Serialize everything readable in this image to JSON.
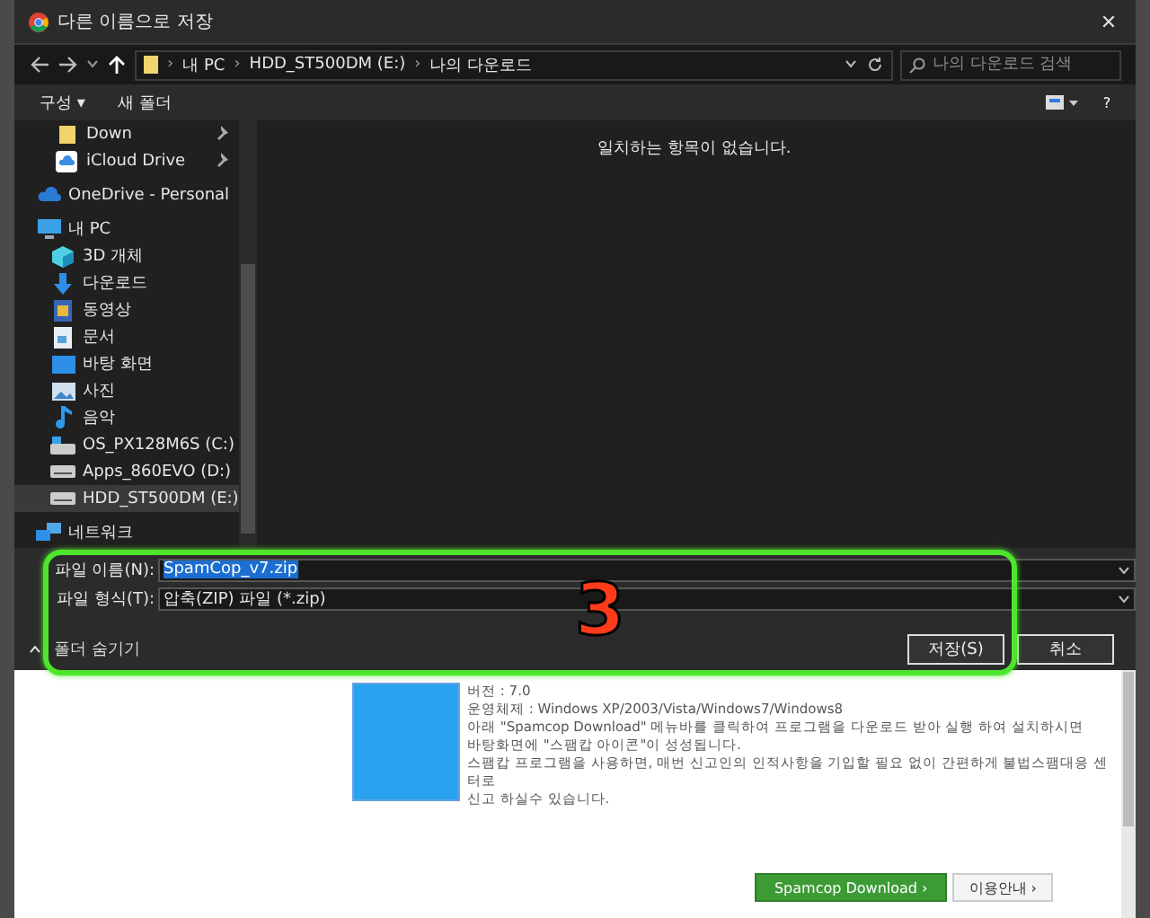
{
  "window": {
    "title": "다른 이름으로 저장",
    "close": "✕"
  },
  "address": {
    "crumbs": [
      "내 PC",
      "HDD_ST500DM (E:)",
      "나의 다운로드"
    ],
    "separator": "›"
  },
  "search": {
    "placeholder": "나의 다운로드 검색"
  },
  "toolbar": {
    "organize": "구성 ▾",
    "new_folder": "새 폴더",
    "help": "?"
  },
  "sidebar": {
    "items": [
      {
        "label": "Down",
        "kind": "folder",
        "pinned": true,
        "selected": false
      },
      {
        "label": "iCloud Drive",
        "kind": "cloud",
        "pinned": true,
        "selected": false
      },
      {
        "label": "OneDrive - Personal",
        "kind": "onedrive",
        "pinned": false,
        "selected": false
      },
      {
        "label": "내 PC",
        "kind": "computer",
        "pinned": false,
        "selected": false,
        "children": [
          {
            "label": "3D 개체",
            "kind": "objects3d",
            "selected": false
          },
          {
            "label": "다운로드",
            "kind": "downloads",
            "selected": false
          },
          {
            "label": "동영상",
            "kind": "videos",
            "selected": false
          },
          {
            "label": "문서",
            "kind": "documents",
            "selected": false
          },
          {
            "label": "바탕 화면",
            "kind": "desktop",
            "selected": false
          },
          {
            "label": "사진",
            "kind": "pictures",
            "selected": false
          },
          {
            "label": "음악",
            "kind": "music",
            "selected": false
          },
          {
            "label": "OS_PX128M6S (C:)",
            "kind": "system-drive",
            "selected": false
          },
          {
            "label": "Apps_860EVO (D:)",
            "kind": "drive",
            "selected": false
          },
          {
            "label": "HDD_ST500DM (E:)",
            "kind": "drive",
            "selected": true
          }
        ]
      },
      {
        "label": "네트워크",
        "kind": "network",
        "pinned": false,
        "selected": false
      }
    ]
  },
  "content": {
    "empty_message": "일치하는 항목이 없습니다."
  },
  "form": {
    "filename_label": "파일 이름(N):",
    "filename": "SpamCop_v7.zip",
    "filetype_label": "파일 형식(T):",
    "filetype": "압축(ZIP) 파일 (*.zip)",
    "hide_folders": "폴더 숨기기",
    "save": "저장(S)",
    "cancel": "취소"
  },
  "annotation": {
    "number": "3"
  },
  "webpage": {
    "lines": [
      "버전 : 7.0",
      "운영체제 : Windows XP/2003/Vista/Windows7/Windows8",
      "아래 \"Spamcop Download\" 메뉴바를 클릭하여 프로그램을 다운로드 받아 실행 하여 설치하시면",
      "바탕화면에 \"스팸캅 아이콘\"이 성성됩니다.",
      "스팸캅 프로그램을 사용하면, 매번 신고인의 인적사항을 기입할 필요 없이 간편하게 불법스팸대응 센터로",
      "신고 하실수 있습니다."
    ],
    "download_button": "Spamcop Download ›",
    "guide_button": "이용안내 ›"
  }
}
